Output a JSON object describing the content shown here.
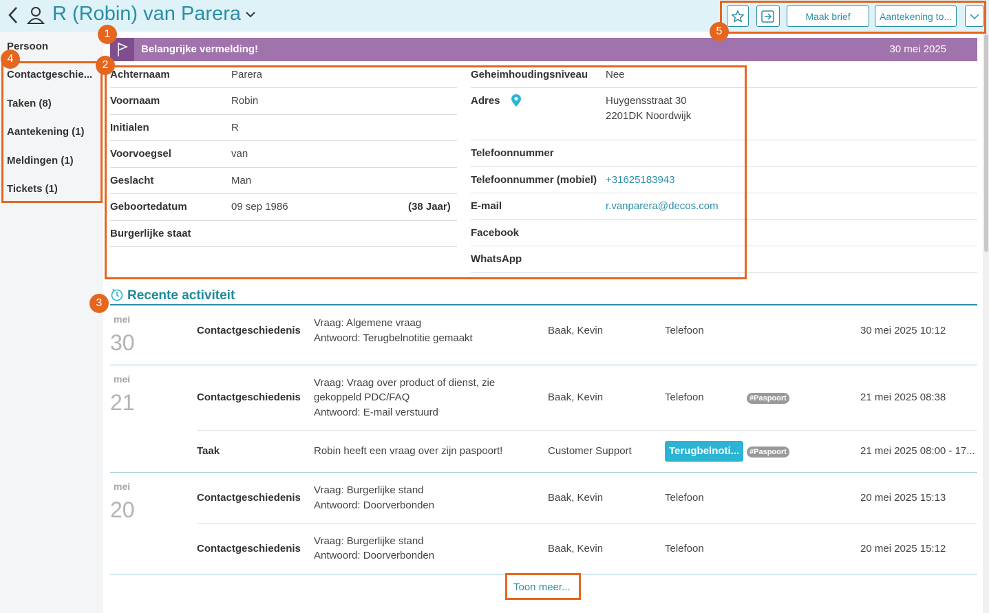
{
  "header": {
    "title": "R (Robin) van Parera",
    "back_icon": "chevron-left-icon",
    "person_icon": "person-icon",
    "toolbar": {
      "star_icon": "star-icon",
      "exit_icon": "exit-icon",
      "maak_brief": "Maak brief",
      "aantekening": "Aantekening to...",
      "more_icon": "chevron-down-icon"
    }
  },
  "sidebar": {
    "items": [
      {
        "label": "Persoon"
      },
      {
        "label": "Contactgeschie..."
      },
      {
        "label": "Taken (8)"
      },
      {
        "label": "Aantekening (1)"
      },
      {
        "label": "Meldingen (1)"
      },
      {
        "label": "Tickets (1)"
      }
    ]
  },
  "banner": {
    "text": "Belangrijke vermelding!",
    "date": "30 mei 2025",
    "color": "#a073ac"
  },
  "details": {
    "left": [
      {
        "label": "Achternaam",
        "value": "Parera"
      },
      {
        "label": "Voornaam",
        "value": "Robin"
      },
      {
        "label": "Initialen",
        "value": "R"
      },
      {
        "label": "Voorvoegsel",
        "value": "van"
      },
      {
        "label": "Geslacht",
        "value": "Man"
      },
      {
        "label": "Geboortedatum",
        "value": "09 sep 1986",
        "extra": "(38 Jaar)"
      },
      {
        "label": "Burgerlijke staat",
        "value": ""
      }
    ],
    "right": [
      {
        "label": "Geheimhoudingsniveau",
        "value": "Nee"
      },
      {
        "label": "Adres",
        "value": "Huygensstraat 30",
        "value2": "2201DK Noordwijk"
      },
      {
        "label": "Telefoonnummer",
        "value": ""
      },
      {
        "label": "Telefoonnummer (mobiel)",
        "value": "+31625183943"
      },
      {
        "label": "E-mail",
        "value": "r.vanparera@decos.com"
      },
      {
        "label": "Facebook",
        "value": ""
      },
      {
        "label": "WhatsApp",
        "value": ""
      }
    ]
  },
  "activity": {
    "title": "Recente activiteit",
    "groups": [
      {
        "month": "mei",
        "day": "30",
        "items": [
          {
            "type": "Contactgeschiedenis",
            "lines": [
              "Vraag: Algemene vraag",
              "Antwoord: Terugbelnotitie gemaakt"
            ],
            "who": "Baak, Kevin",
            "channel": "Telefoon",
            "time": "30 mei 2025 10:12"
          }
        ]
      },
      {
        "month": "mei",
        "day": "21",
        "items": [
          {
            "type": "Contactgeschiedenis",
            "lines": [
              "Vraag: Vraag over product of dienst, zie",
              "gekoppeld PDC/FAQ",
              "Antwoord: E-mail verstuurd"
            ],
            "who": "Baak, Kevin",
            "channel": "Telefoon",
            "tag": "#Paspoort",
            "time": "21 mei 2025 08:38"
          },
          {
            "type": "Taak",
            "lines": [
              "Robin heeft een vraag over zijn paspoort!"
            ],
            "who": "Customer Support",
            "status": "Terugbelnoti...",
            "tag": "#Paspoort",
            "time": "21 mei 2025 08:00 - 17..."
          }
        ]
      },
      {
        "month": "mei",
        "day": "20",
        "items": [
          {
            "type": "Contactgeschiedenis",
            "lines": [
              "Vraag: Burgerlijke stand",
              "Antwoord: Doorverbonden"
            ],
            "who": "Baak, Kevin",
            "channel": "Telefoon",
            "time": "20 mei 2025 15:13"
          },
          {
            "type": "Contactgeschiedenis",
            "lines": [
              "Vraag: Burgerlijke stand",
              "Antwoord: Doorverbonden"
            ],
            "who": "Baak, Kevin",
            "channel": "Telefoon",
            "time": "20 mei 2025 15:12"
          }
        ]
      }
    ],
    "show_more": "Toon meer..."
  },
  "annotations": [
    "1",
    "2",
    "3",
    "4",
    "5"
  ],
  "colors": {
    "accent": "#2a8ea6",
    "annotation": "#e5661f",
    "badge": "#2bb4d4"
  }
}
